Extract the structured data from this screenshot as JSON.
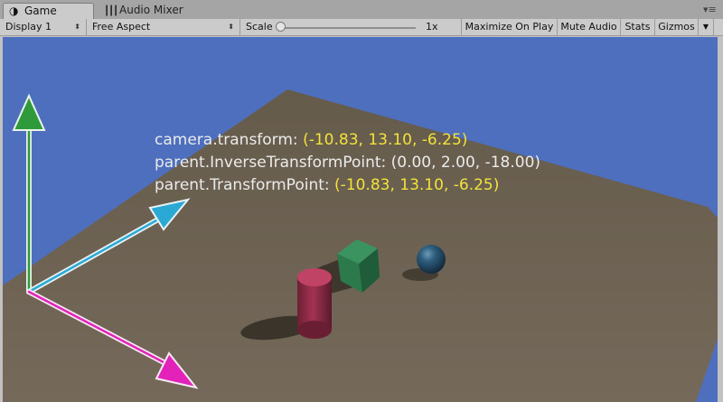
{
  "tabs": [
    {
      "label": "Game",
      "icon": "game-icon",
      "active": true
    },
    {
      "label": "Audio Mixer",
      "icon": "audio-mixer-icon",
      "active": false
    }
  ],
  "toolbar": {
    "display": "Display 1",
    "aspect": "Free Aspect",
    "scale_label": "Scale",
    "scale_value": "1x",
    "scale_level": 0,
    "maximize": "Maximize On Play",
    "mute": "Mute Audio",
    "stats": "Stats",
    "gizmos": "Gizmos"
  },
  "overlay": [
    {
      "label": "camera.transform: ",
      "value": "(-10.83, 13.10, -6.25)",
      "highlight": true
    },
    {
      "label": "parent.InverseTransformPoint: ",
      "value": "(0.00, 2.00, -18.00)",
      "highlight": false
    },
    {
      "label": "parent.TransformPoint: ",
      "value": "(-10.83, 13.10, -6.25)",
      "highlight": true
    }
  ],
  "colors": {
    "sky": "#4d6fbd",
    "ground": "#6b6150",
    "highlight_text": "#f2e33a",
    "axis_y": "#2e9a3a",
    "axis_z": "#2aa9d4",
    "axis_x": "#e222b8",
    "cube": "#2e7d4f",
    "cylinder": "#a03350",
    "sphere": "#2a5a78"
  }
}
